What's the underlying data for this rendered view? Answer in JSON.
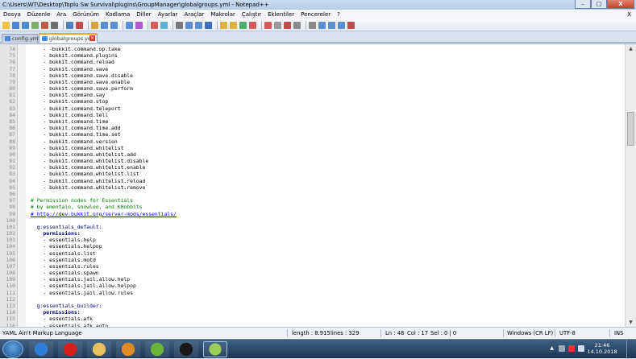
{
  "window": {
    "title": "C:\\Users\\WT\\Desktop\\Toplu Sw Survival\\plugins\\GroupManager\\globalgroups.yml - Notepad++",
    "controls": {
      "minimize": "–",
      "maximize": "□",
      "close": "X"
    }
  },
  "menu": {
    "items": [
      "Dosya",
      "Düzenle",
      "Ara",
      "Görünüm",
      "Kodlama",
      "Diller",
      "Ayarlar",
      "Araçlar",
      "Makrolar",
      "Çalıştır",
      "Eklentiler",
      "Pencereler",
      "?"
    ],
    "close_doc": "X"
  },
  "toolbar": {
    "button_colors": [
      "#f0c24a",
      "#4a87d6",
      "#4a87d6",
      "#7ab06a",
      "#c25a4a",
      "#6f6f6f",
      "#4f7fbf",
      "#c24a4a",
      "#d9a53a",
      "#5a8fd6",
      "#5a8fd6",
      "#5a8fd6",
      "#b05ad6",
      "#d65a5a",
      "#5ab0d6",
      "#7a7a7a",
      "#5a8fd6",
      "#5a8fd6",
      "#3a6fc2",
      "#e0b040",
      "#e0b040",
      "#4ab06a",
      "#d65a5a",
      "#d65a5a",
      "#9a9a9a",
      "#c24a4a",
      "#8a8a8a",
      "#8a8a8a",
      "#5a8fd6",
      "#5a8fd6",
      "#5a8fd6",
      "#c24a4a"
    ]
  },
  "tabs": [
    {
      "label": "config.yml",
      "active": false
    },
    {
      "label": "globalgroups.yml",
      "active": true
    }
  ],
  "editor": {
    "lines": [
      {
        "n": "74",
        "text": "    - -bukkit.command.op.take",
        "type": "item"
      },
      {
        "n": "75",
        "text": "    - bukkit.command.plugins",
        "type": "item"
      },
      {
        "n": "76",
        "text": "    - bukkit.command.reload",
        "type": "item"
      },
      {
        "n": "77",
        "text": "    - bukkit.command.save",
        "type": "item"
      },
      {
        "n": "78",
        "text": "    - bukkit.command.save.disable",
        "type": "item"
      },
      {
        "n": "79",
        "text": "    - bukkit.command.save.enable",
        "type": "item"
      },
      {
        "n": "80",
        "text": "    - bukkit.command.save.perform",
        "type": "item"
      },
      {
        "n": "81",
        "text": "    - bukkit.command.say",
        "type": "item"
      },
      {
        "n": "82",
        "text": "    - bukkit.command.stop",
        "type": "item"
      },
      {
        "n": "83",
        "text": "    - bukkit.command.teleport",
        "type": "item"
      },
      {
        "n": "84",
        "text": "    - bukkit.command.tell",
        "type": "item"
      },
      {
        "n": "85",
        "text": "    - bukkit.command.time",
        "type": "item"
      },
      {
        "n": "86",
        "text": "    - bukkit.command.time.add",
        "type": "item"
      },
      {
        "n": "87",
        "text": "    - bukkit.command.time.set",
        "type": "item"
      },
      {
        "n": "88",
        "text": "    - bukkit.command.version",
        "type": "item"
      },
      {
        "n": "89",
        "text": "    - bukkit.command.whitelist",
        "type": "item"
      },
      {
        "n": "90",
        "text": "    - bukkit.command.whitelist.add",
        "type": "item"
      },
      {
        "n": "91",
        "text": "    - bukkit.command.whitelist.disable",
        "type": "item"
      },
      {
        "n": "92",
        "text": "    - bukkit.command.whitelist.enable",
        "type": "item"
      },
      {
        "n": "93",
        "text": "    - bukkit.command.whitelist.list",
        "type": "item"
      },
      {
        "n": "94",
        "text": "    - bukkit.command.whitelist.reload",
        "type": "item"
      },
      {
        "n": "95",
        "text": "    - bukkit.command.whitelist.remove",
        "type": "item"
      },
      {
        "n": "96",
        "text": "",
        "type": "item"
      },
      {
        "n": "97",
        "text": "# Permission nodes for Essentials",
        "type": "comment"
      },
      {
        "n": "98",
        "text": "# by ementalo, snowleo, and KHobbits",
        "type": "comment"
      },
      {
        "n": "99",
        "text": "# http://dev.bukkit.org/server-mods/essentials/",
        "type": "link"
      },
      {
        "n": "100",
        "text": "",
        "type": "item"
      },
      {
        "n": "101",
        "text": "  g:essentials_default:",
        "type": "key"
      },
      {
        "n": "102",
        "text": "    permissions:",
        "type": "key2"
      },
      {
        "n": "103",
        "text": "    - essentials.help",
        "type": "item"
      },
      {
        "n": "104",
        "text": "    - essentials.helpop",
        "type": "item"
      },
      {
        "n": "105",
        "text": "    - essentials.list",
        "type": "item"
      },
      {
        "n": "106",
        "text": "    - essentials.motd",
        "type": "item"
      },
      {
        "n": "107",
        "text": "    - essentials.rules",
        "type": "item"
      },
      {
        "n": "108",
        "text": "    - essentials.spawn",
        "type": "item"
      },
      {
        "n": "109",
        "text": "    - essentials.jail.allow.help",
        "type": "item"
      },
      {
        "n": "110",
        "text": "    - essentials.jail.allow.helpop",
        "type": "item"
      },
      {
        "n": "111",
        "text": "    - essentials.jail.allow.rules",
        "type": "item"
      },
      {
        "n": "112",
        "text": "",
        "type": "item"
      },
      {
        "n": "113",
        "text": "  g:essentials_builder:",
        "type": "key"
      },
      {
        "n": "114",
        "text": "    permissions:",
        "type": "key2"
      },
      {
        "n": "115",
        "text": "    - essentials.afk",
        "type": "item"
      },
      {
        "n": "116",
        "text": "    - essentials.afk.auto",
        "type": "item"
      }
    ]
  },
  "status": {
    "language": "YAML Ain't Markup Language",
    "length": "length : 8.915",
    "lines": "lines : 329",
    "ln": "Ln : 48",
    "col": "Col : 17",
    "sel": "Sel : 0 | 0",
    "eol": "Windows (CR LF)",
    "encoding": "UTF-8",
    "mode": "INS"
  },
  "taskbar": {
    "apps": [
      {
        "name": "ie-icon",
        "color": "#2f7fd6"
      },
      {
        "name": "opera-icon",
        "color": "#d6201e"
      },
      {
        "name": "explorer-folder-icon",
        "color": "#e8c060"
      },
      {
        "name": "media-player-icon",
        "color": "#e08a2a"
      },
      {
        "name": "utorrent-icon",
        "color": "#6ab43a"
      },
      {
        "name": "cmd-icon",
        "color": "#1a1a1a"
      },
      {
        "name": "notepadpp-icon",
        "color": "#9acd5a"
      }
    ],
    "time": "21:46",
    "date": "14.10.2018"
  }
}
